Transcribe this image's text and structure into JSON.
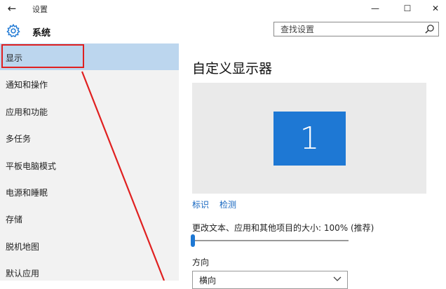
{
  "window": {
    "title": "设置",
    "back_glyph": "←",
    "minimize_glyph": "—",
    "maximize_glyph": "☐",
    "close_glyph": "✕"
  },
  "header": {
    "section_title": "系统",
    "icon": "gear-icon"
  },
  "search": {
    "placeholder": "查找设置",
    "value": "",
    "icon": "search-icon"
  },
  "sidebar": {
    "items": [
      {
        "label": "显示",
        "selected": true
      },
      {
        "label": "通知和操作",
        "selected": false
      },
      {
        "label": "应用和功能",
        "selected": false
      },
      {
        "label": "多任务",
        "selected": false
      },
      {
        "label": "平板电脑模式",
        "selected": false
      },
      {
        "label": "电源和睡眠",
        "selected": false
      },
      {
        "label": "存储",
        "selected": false
      },
      {
        "label": "脱机地图",
        "selected": false
      },
      {
        "label": "默认应用",
        "selected": false
      }
    ]
  },
  "main": {
    "title": "自定义显示器",
    "monitor_number": "1",
    "links": {
      "identify": "标识",
      "detect": "检测"
    },
    "scale_label": "更改文本、应用和其他项目的大小: 100% (推荐)",
    "scale_percent": 100,
    "scale_slider_fraction": 0,
    "orientation_label": "方向",
    "orientation_value": "横向"
  },
  "colors": {
    "accent": "#1e78d4",
    "selected_item": "#bcd6ee",
    "sidebar_bg": "#f2f2f2",
    "preview_bg": "#eaeaea",
    "annotation_red": "#e02020",
    "link": "#1566c0"
  }
}
